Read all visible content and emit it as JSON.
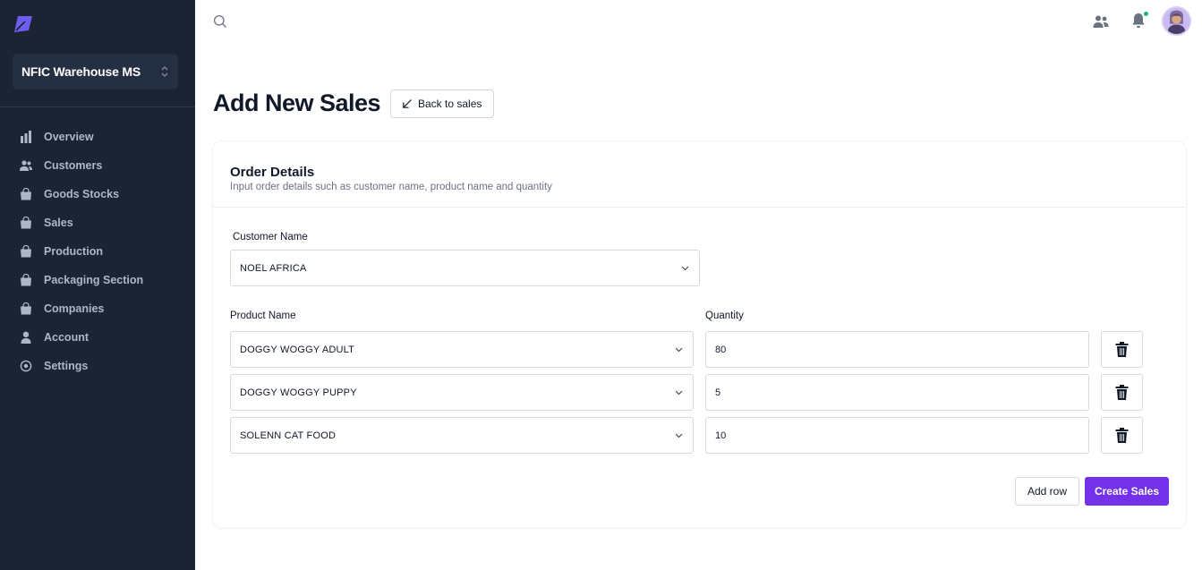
{
  "colors": {
    "sidebar_bg": "#1c2434",
    "accent": "#7431ea",
    "status_dot": "#10b981"
  },
  "sidebar": {
    "logo_icon": "leaf-logo-icon",
    "workspace": {
      "name": "NFIC Warehouse MS",
      "icon": "chevron-up-down-icon"
    },
    "items": [
      {
        "label": "Overview",
        "icon": "bar-chart-icon"
      },
      {
        "label": "Customers",
        "icon": "users-icon"
      },
      {
        "label": "Goods Stocks",
        "icon": "shopping-bag-icon"
      },
      {
        "label": "Sales",
        "icon": "shopping-bag-icon"
      },
      {
        "label": "Production",
        "icon": "shopping-bag-icon"
      },
      {
        "label": "Packaging Section",
        "icon": "shopping-bag-icon"
      },
      {
        "label": "Companies",
        "icon": "shopping-bag-icon"
      },
      {
        "label": "Account",
        "icon": "user-icon"
      },
      {
        "label": "Settings",
        "icon": "gear-icon"
      }
    ]
  },
  "topbar": {
    "search_icon": "search-icon",
    "contacts_icon": "users-icon",
    "notifications_icon": "bell-icon",
    "avatar": "user-avatar"
  },
  "page": {
    "title": "Add New Sales",
    "back_label": "Back to sales"
  },
  "card": {
    "title": "Order Details",
    "subtitle": "Input order details such as customer name, product name and quantity",
    "customer_label": "Customer Name",
    "customer_value": "NOEL AFRICA",
    "product_label": "Product Name",
    "quantity_label": "Quantity",
    "rows": [
      {
        "product": "DOGGY WOGGY ADULT",
        "quantity": "80"
      },
      {
        "product": "DOGGY WOGGY PUPPY",
        "quantity": "5"
      },
      {
        "product": "SOLENN CAT FOOD",
        "quantity": "10"
      }
    ],
    "add_row_label": "Add row",
    "create_label": "Create Sales"
  }
}
